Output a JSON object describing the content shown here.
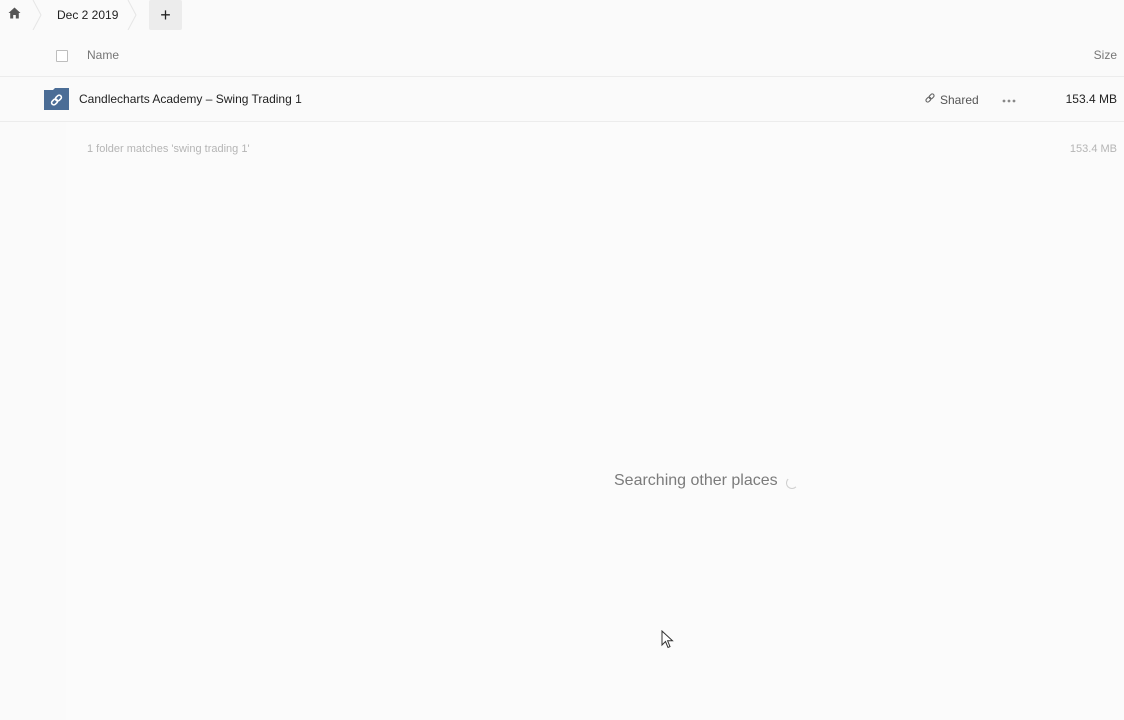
{
  "breadcrumb": {
    "home_icon": "home-icon",
    "current": "Dec 2 2019",
    "new_label": "+"
  },
  "list": {
    "header": {
      "name": "Name",
      "size": "Size"
    },
    "rows": [
      {
        "icon": "shared-folder-link-icon",
        "name": "Candlecharts Academy – Swing Trading 1",
        "shared_label": "Shared",
        "size": "153.4 MB"
      }
    ],
    "summary": "1 folder matches 'swing trading 1'",
    "summary_size": "153.4 MB"
  },
  "status": {
    "searching_text": "Searching other places"
  },
  "colors": {
    "folder_icon": "#4b6d96",
    "background": "#fafafa",
    "muted_text": "#b5b5b5"
  }
}
